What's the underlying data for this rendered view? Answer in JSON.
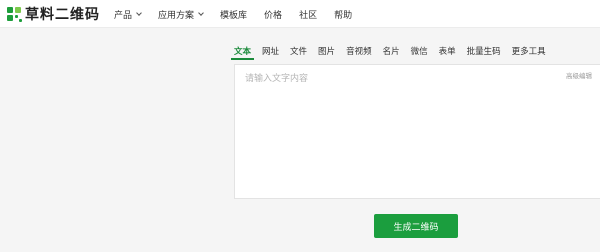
{
  "logo": {
    "text": "草料二维码"
  },
  "nav": [
    {
      "label": "产品",
      "has_dropdown": true
    },
    {
      "label": "应用方案",
      "has_dropdown": true
    },
    {
      "label": "模板库",
      "has_dropdown": false
    },
    {
      "label": "价格",
      "has_dropdown": false
    },
    {
      "label": "社区",
      "has_dropdown": false
    },
    {
      "label": "帮助",
      "has_dropdown": false
    }
  ],
  "tabs": [
    {
      "label": "文本",
      "active": true
    },
    {
      "label": "网址",
      "active": false
    },
    {
      "label": "文件",
      "active": false
    },
    {
      "label": "图片",
      "active": false
    },
    {
      "label": "音视频",
      "active": false
    },
    {
      "label": "名片",
      "active": false
    },
    {
      "label": "微信",
      "active": false
    },
    {
      "label": "表单",
      "active": false
    },
    {
      "label": "批量生码",
      "active": false
    },
    {
      "label": "更多工具",
      "active": false
    }
  ],
  "editor": {
    "value": "",
    "placeholder": "请输入文字内容",
    "advanced_label": "高级编辑"
  },
  "generate_button": {
    "label": "生成二维码"
  },
  "colors": {
    "brand": "#1b9e3e",
    "accent": "#7cc94b",
    "background": "#f5f5f5"
  }
}
